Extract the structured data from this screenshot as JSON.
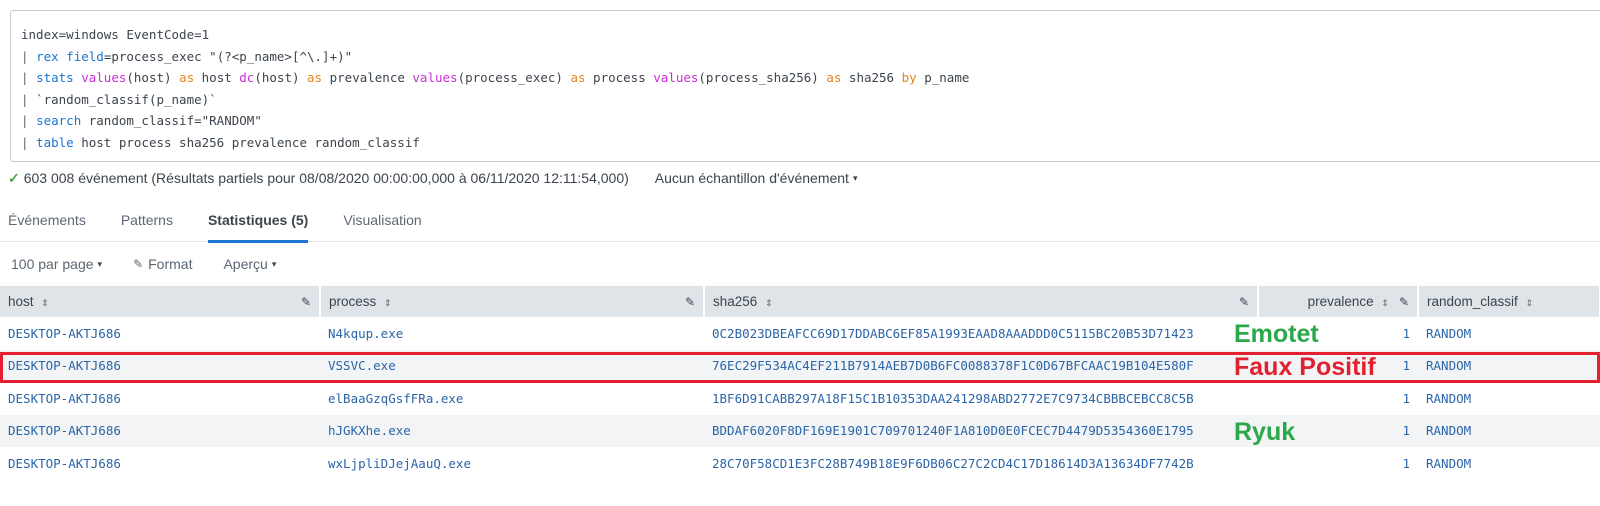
{
  "search": {
    "lines": [
      [
        {
          "t": "index=windows EventCode=1",
          "c": "plain"
        }
      ],
      [
        {
          "t": "| ",
          "c": "pipe"
        },
        {
          "t": "rex ",
          "c": "cmd"
        },
        {
          "t": "field",
          "c": "arg"
        },
        {
          "t": "=process_exec \"(?<p_name>[^\\.]+)\"",
          "c": "plain"
        }
      ],
      [
        {
          "t": "| ",
          "c": "pipe"
        },
        {
          "t": "stats ",
          "c": "cmd"
        },
        {
          "t": "values",
          "c": "fn"
        },
        {
          "t": "(host) ",
          "c": "plain"
        },
        {
          "t": "as",
          "c": "kw"
        },
        {
          "t": " host ",
          "c": "plain"
        },
        {
          "t": "dc",
          "c": "fn"
        },
        {
          "t": "(host) ",
          "c": "plain"
        },
        {
          "t": "as",
          "c": "kw"
        },
        {
          "t": " prevalence ",
          "c": "plain"
        },
        {
          "t": "values",
          "c": "fn"
        },
        {
          "t": "(process_exec) ",
          "c": "plain"
        },
        {
          "t": "as",
          "c": "kw"
        },
        {
          "t": " process ",
          "c": "plain"
        },
        {
          "t": "values",
          "c": "fn"
        },
        {
          "t": "(process_sha256) ",
          "c": "plain"
        },
        {
          "t": "as",
          "c": "kw"
        },
        {
          "t": " sha256 ",
          "c": "plain"
        },
        {
          "t": "by",
          "c": "kw"
        },
        {
          "t": " p_name",
          "c": "plain"
        }
      ],
      [
        {
          "t": "| ",
          "c": "pipe"
        },
        {
          "t": "`random_classif(p_name)`",
          "c": "plain"
        }
      ],
      [
        {
          "t": "| ",
          "c": "pipe"
        },
        {
          "t": "search ",
          "c": "cmd"
        },
        {
          "t": "random_classif=\"RANDOM\"",
          "c": "plain"
        }
      ],
      [
        {
          "t": "| ",
          "c": "pipe"
        },
        {
          "t": "table ",
          "c": "cmd"
        },
        {
          "t": "host process sha256 prevalence random_classif",
          "c": "plain"
        }
      ]
    ]
  },
  "status": {
    "check": "✓",
    "text": "603 008 événement (Résultats partiels pour 08/08/2020 00:00:00,000 à 06/11/2020 12:11:54,000)",
    "sampling": "Aucun échantillon d'événement",
    "caret": "▾"
  },
  "tabs": [
    "Événements",
    "Patterns",
    "Statistiques (5)",
    "Visualisation"
  ],
  "toolbar": {
    "per_page": "100 par page",
    "format": "Format",
    "preview": "Aperçu",
    "caret": "▾",
    "pencil": "✎"
  },
  "table": {
    "headers": {
      "host": "host",
      "process": "process",
      "sha256": "sha256",
      "prevalence": "prevalence",
      "random_classif": "random_classif",
      "sort": "⇕",
      "edit": "✎"
    },
    "rows": [
      {
        "host": "DESKTOP-AKTJ686",
        "process": "N4kqup.exe",
        "sha256": "0C2B023DBEAFCC69D17DDABC6EF85A1993EAAD8AAADDD0C5115BC20B53D71423",
        "prevalence": "1",
        "random_classif": "RANDOM"
      },
      {
        "host": "DESKTOP-AKTJ686",
        "process": "VSSVC.exe",
        "sha256": "76EC29F534AC4EF211B7914AEB7D0B6FC0088378F1C0D67BFCAAC19B104E580F",
        "prevalence": "1",
        "random_classif": "RANDOM"
      },
      {
        "host": "DESKTOP-AKTJ686",
        "process": "elBaaGzqGsfFRa.exe",
        "sha256": "1BF6D91CABB297A18F15C1B10353DAA241298ABD2772E7C9734CBBBCEBCC8C5B",
        "prevalence": "1",
        "random_classif": "RANDOM"
      },
      {
        "host": "DESKTOP-AKTJ686",
        "process": "hJGKXhe.exe",
        "sha256": "BDDAF6020F8DF169E1901C709701240F1A810D0E0FCEC7D4479D5354360E1795",
        "prevalence": "1",
        "random_classif": "RANDOM"
      },
      {
        "host": "DESKTOP-AKTJ686",
        "process": "wxLjpliDJejAauQ.exe",
        "sha256": "28C70F58CD1E3FC28B749B18E9F6DB06C27C2CD4C17D18614D3A13634DF7742B",
        "prevalence": "1",
        "random_classif": "RANDOM"
      }
    ]
  },
  "annotations": [
    {
      "text": "Emotet",
      "color": "#2aa84a",
      "row": 0
    },
    {
      "text": "Faux Positif",
      "color": "#e3202f",
      "row": 1
    },
    {
      "text": "Ryuk",
      "color": "#2aa84a",
      "row": 3
    }
  ]
}
